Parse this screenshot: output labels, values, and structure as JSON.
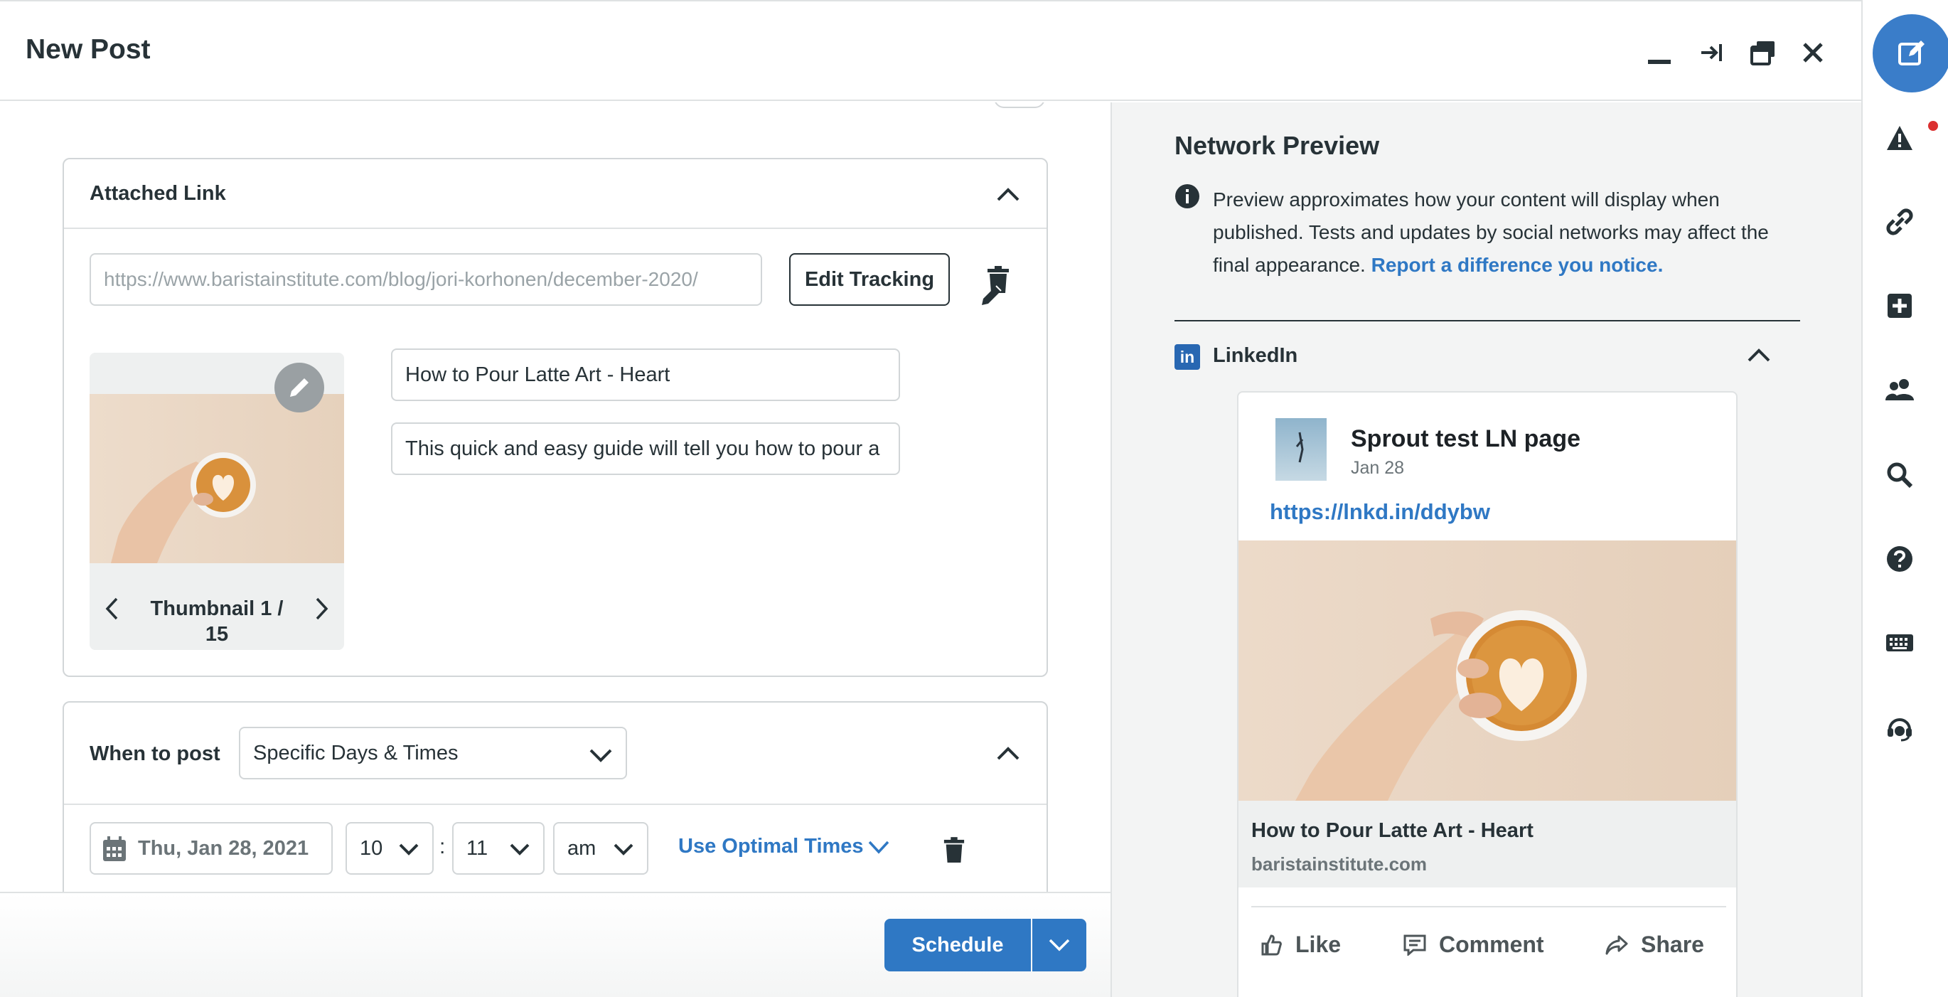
{
  "header": {
    "title": "New Post",
    "controls": [
      "minimize-icon",
      "collapse-icon",
      "popout-icon",
      "close-icon"
    ]
  },
  "attached_link": {
    "title": "Attached Link",
    "url": "https://www.baristainstitute.com/blog/jori-korhonen/december-2020/",
    "edit_tracking_label": "Edit Tracking",
    "thumbnail_label": "Thumbnail 1 / 15",
    "link_title": "How to Pour Latte Art - Heart",
    "link_description": "This quick and easy guide will tell you how to pour a"
  },
  "when_to_post": {
    "label": "When to post",
    "mode": "Specific Days & Times",
    "date": "Thu, Jan 28, 2021",
    "hour": "10",
    "minute": "11",
    "ampm": "am",
    "separator": ":",
    "optimal_label": "Use Optimal Times"
  },
  "footer": {
    "schedule_label": "Schedule"
  },
  "preview": {
    "title": "Network Preview",
    "description": "Preview approximates how your content will display when published. Tests and updates by social networks may affect the final appearance.",
    "report_link": "Report a difference you notice.",
    "network_badge": "in",
    "network_label": "LinkedIn",
    "page_name": "Sprout test LN page",
    "post_date": "Jan 28",
    "short_url": "https://lnkd.in/ddybw",
    "card_title": "How to Pour Latte Art - Heart",
    "card_domain": "baristainstitute.com",
    "actions": [
      "Like",
      "Comment",
      "Share"
    ]
  },
  "colors": {
    "accent": "#2f78c4",
    "compose": "#3a7dc9",
    "linkedin": "#2867b2",
    "alert_dot": "#db3030"
  }
}
